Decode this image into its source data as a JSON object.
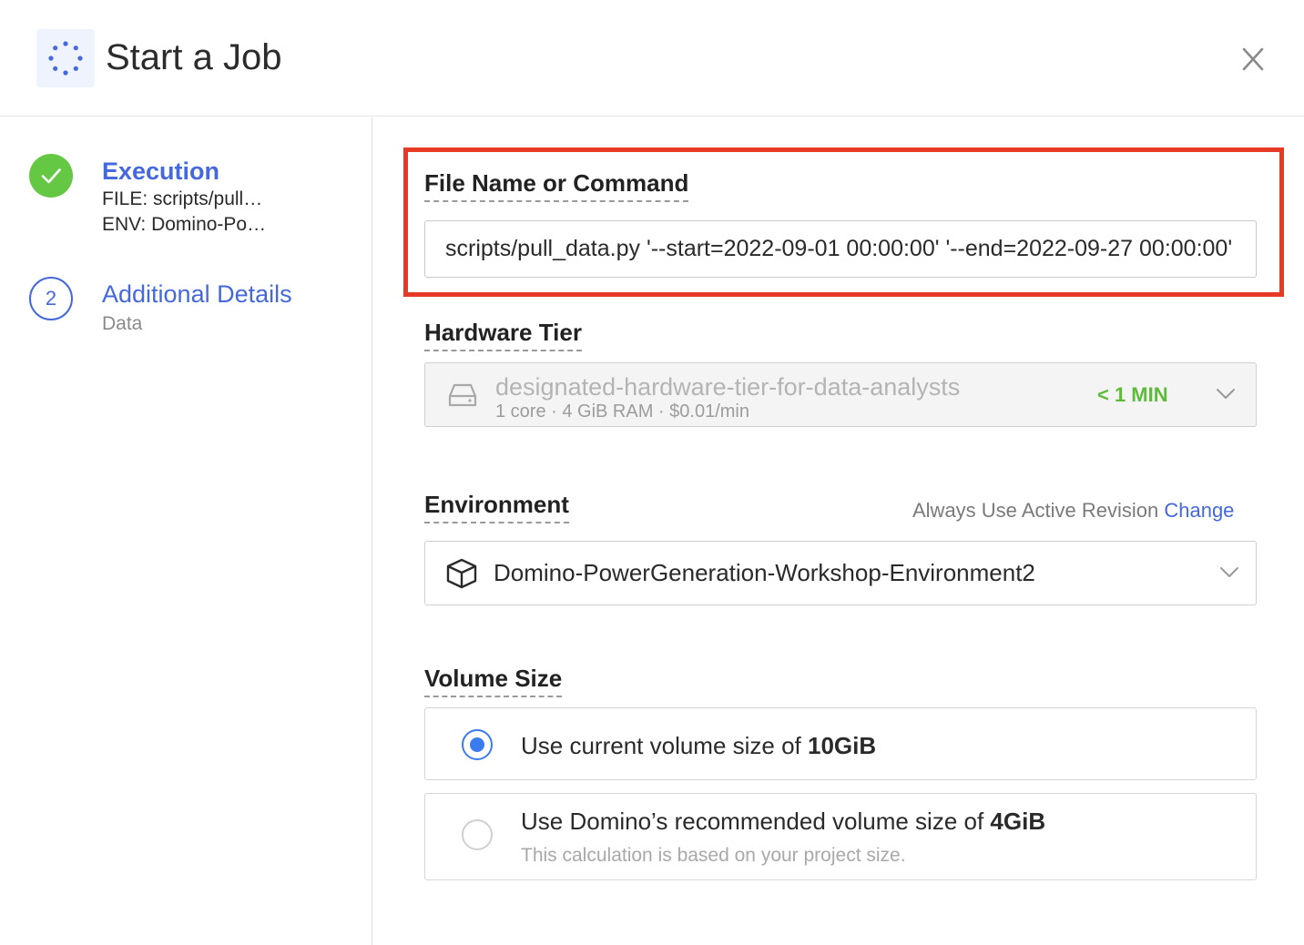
{
  "header": {
    "title": "Start a Job",
    "icon": "job-spinner-icon",
    "close_icon": "close-icon"
  },
  "steps": [
    {
      "title": "Execution",
      "status": "complete",
      "lines": [
        "FILE: scripts/pull…",
        "ENV: Domino-Po…"
      ]
    },
    {
      "number": "2",
      "title": "Additional Details",
      "lines": [
        "Data"
      ]
    }
  ],
  "command": {
    "label": "File Name or Command",
    "value": "scripts/pull_data.py '--start=2022-09-01 00:00:00' '--end=2022-09-27 00:00:00'"
  },
  "hardware_tier": {
    "label": "Hardware Tier",
    "name": "designated-hardware-tier-for-data-analysts",
    "specs": "1 core · 4 GiB RAM · $0.01/min",
    "start_time": "< 1 MIN",
    "icon": "hard-drive-icon",
    "disabled": true
  },
  "environment": {
    "label": "Environment",
    "revision_text": "Always Use Active Revision",
    "change_link": "Change",
    "selected": "Domino-PowerGeneration-Workshop-Environment2",
    "icon": "cube-icon"
  },
  "volume": {
    "label": "Volume Size",
    "options": [
      {
        "text": "Use current volume size of ",
        "size": "10GiB",
        "selected": true
      },
      {
        "text": "Use Domino’s recommended volume size of ",
        "size": "4GiB",
        "hint": "This calculation is based on your project size.",
        "selected": false
      }
    ]
  },
  "colors": {
    "accent": "#4568dc",
    "success": "#65c845",
    "highlight": "#e63a26",
    "radio": "#3a7bf0"
  }
}
